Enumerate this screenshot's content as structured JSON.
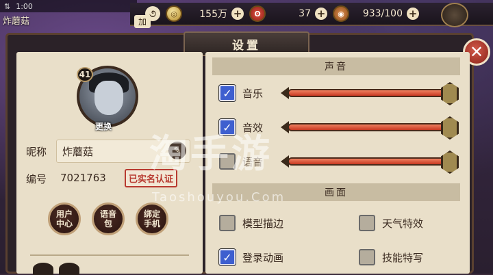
{
  "statusbar": {
    "signal": "⇅",
    "time": "1:00"
  },
  "player": {
    "name_top": "炸蘑菇",
    "name": "炸蘑菇",
    "level": "41",
    "id": "7021763"
  },
  "resources": [
    {
      "icon": "coin-icon",
      "value": "155万"
    },
    {
      "icon": "magatama-icon",
      "value": "37"
    },
    {
      "icon": "stamina-icon",
      "value": "933/100"
    }
  ],
  "topbar": {
    "tag": "加"
  },
  "dialog": {
    "title": "设置"
  },
  "profile": {
    "change_label": "更换",
    "nickname_label": "昵称",
    "id_label": "编号",
    "verified": "已实名认证",
    "buttons": [
      "用户\n中心",
      "语音\n包",
      "绑定\n手机"
    ]
  },
  "sound": {
    "heading": "声音",
    "rows": [
      {
        "label": "音乐",
        "checked": true,
        "level": 0.93
      },
      {
        "label": "音效",
        "checked": true,
        "level": 0.93
      },
      {
        "label": "语音",
        "checked": false,
        "level": 0.93
      }
    ]
  },
  "graphics": {
    "heading": "画面",
    "options": [
      {
        "label": "模型描边",
        "checked": false
      },
      {
        "label": "天气特效",
        "checked": false
      },
      {
        "label": "登录动画",
        "checked": true
      },
      {
        "label": "技能特写",
        "checked": false
      }
    ]
  },
  "watermark": {
    "main": "淘手游",
    "sub": "Taoshouyou.Com"
  },
  "colors": {
    "checked": "#3e5fcf",
    "slider": "#e0603e",
    "panel": "#e9dfc9"
  }
}
